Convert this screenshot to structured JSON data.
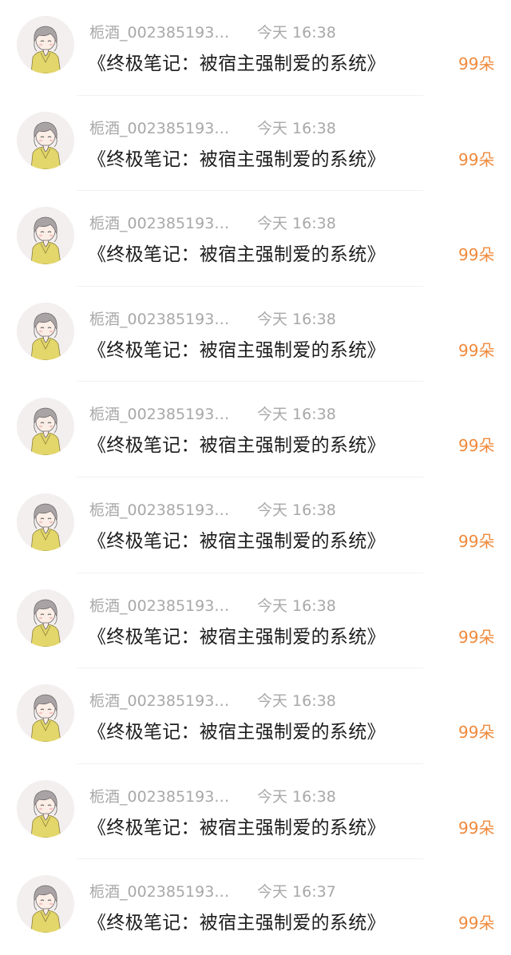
{
  "items": [
    {
      "user": "栀酒_002385193…",
      "time": "今天 16:38",
      "title": "《终极笔记：被宿主强制爱的系统》",
      "count": "99朵"
    },
    {
      "user": "栀酒_002385193…",
      "time": "今天 16:38",
      "title": "《终极笔记：被宿主强制爱的系统》",
      "count": "99朵"
    },
    {
      "user": "栀酒_002385193…",
      "time": "今天 16:38",
      "title": "《终极笔记：被宿主强制爱的系统》",
      "count": "99朵"
    },
    {
      "user": "栀酒_002385193…",
      "time": "今天 16:38",
      "title": "《终极笔记：被宿主强制爱的系统》",
      "count": "99朵"
    },
    {
      "user": "栀酒_002385193…",
      "time": "今天 16:38",
      "title": "《终极笔记：被宿主强制爱的系统》",
      "count": "99朵"
    },
    {
      "user": "栀酒_002385193…",
      "time": "今天 16:38",
      "title": "《终极笔记：被宿主强制爱的系统》",
      "count": "99朵"
    },
    {
      "user": "栀酒_002385193…",
      "time": "今天 16:38",
      "title": "《终极笔记：被宿主强制爱的系统》",
      "count": "99朵"
    },
    {
      "user": "栀酒_002385193…",
      "time": "今天 16:38",
      "title": "《终极笔记：被宿主强制爱的系统》",
      "count": "99朵"
    },
    {
      "user": "栀酒_002385193…",
      "time": "今天 16:38",
      "title": "《终极笔记：被宿主强制爱的系统》",
      "count": "99朵"
    },
    {
      "user": "栀酒_002385193…",
      "time": "今天 16:37",
      "title": "《终极笔记：被宿主强制爱的系统》",
      "count": "99朵"
    }
  ],
  "colors": {
    "count": "#f08a3c",
    "meta": "#a8a8a8",
    "title": "#1c1c1c"
  }
}
